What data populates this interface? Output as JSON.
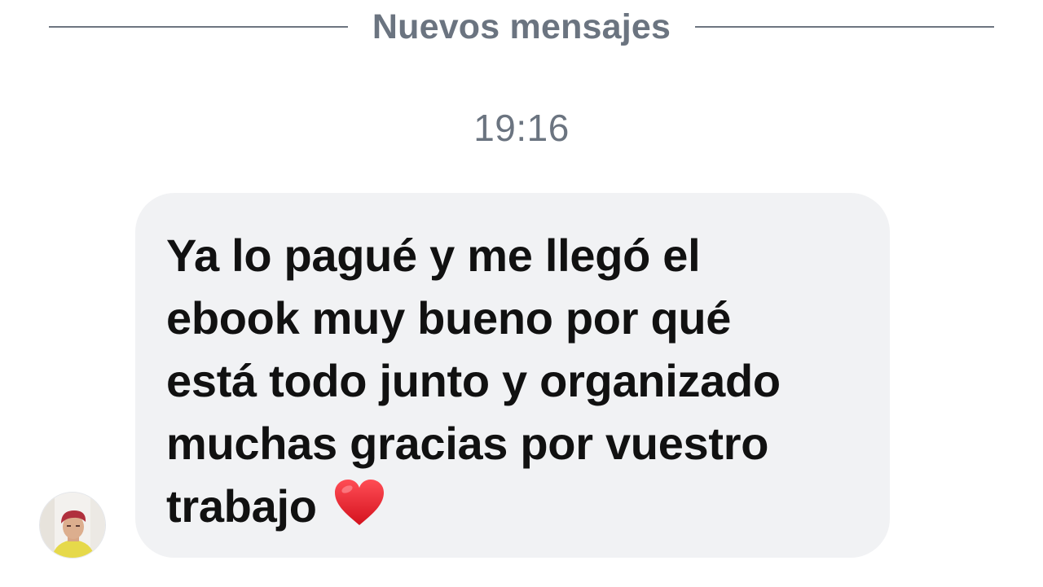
{
  "divider": {
    "label": "Nuevos mensajes"
  },
  "timestamp": "19:16",
  "message": {
    "text": "Ya lo pagué y me llegó el\nebook muy bueno por qué\nestá todo junto y organizado\nmuchas gracias por vuestro\ntrabajo",
    "emoji": "heart-icon"
  },
  "colors": {
    "bubble": "#f1f2f4",
    "meta_text": "#6b7480",
    "message_text": "#111111",
    "heart": "#e8262f"
  }
}
